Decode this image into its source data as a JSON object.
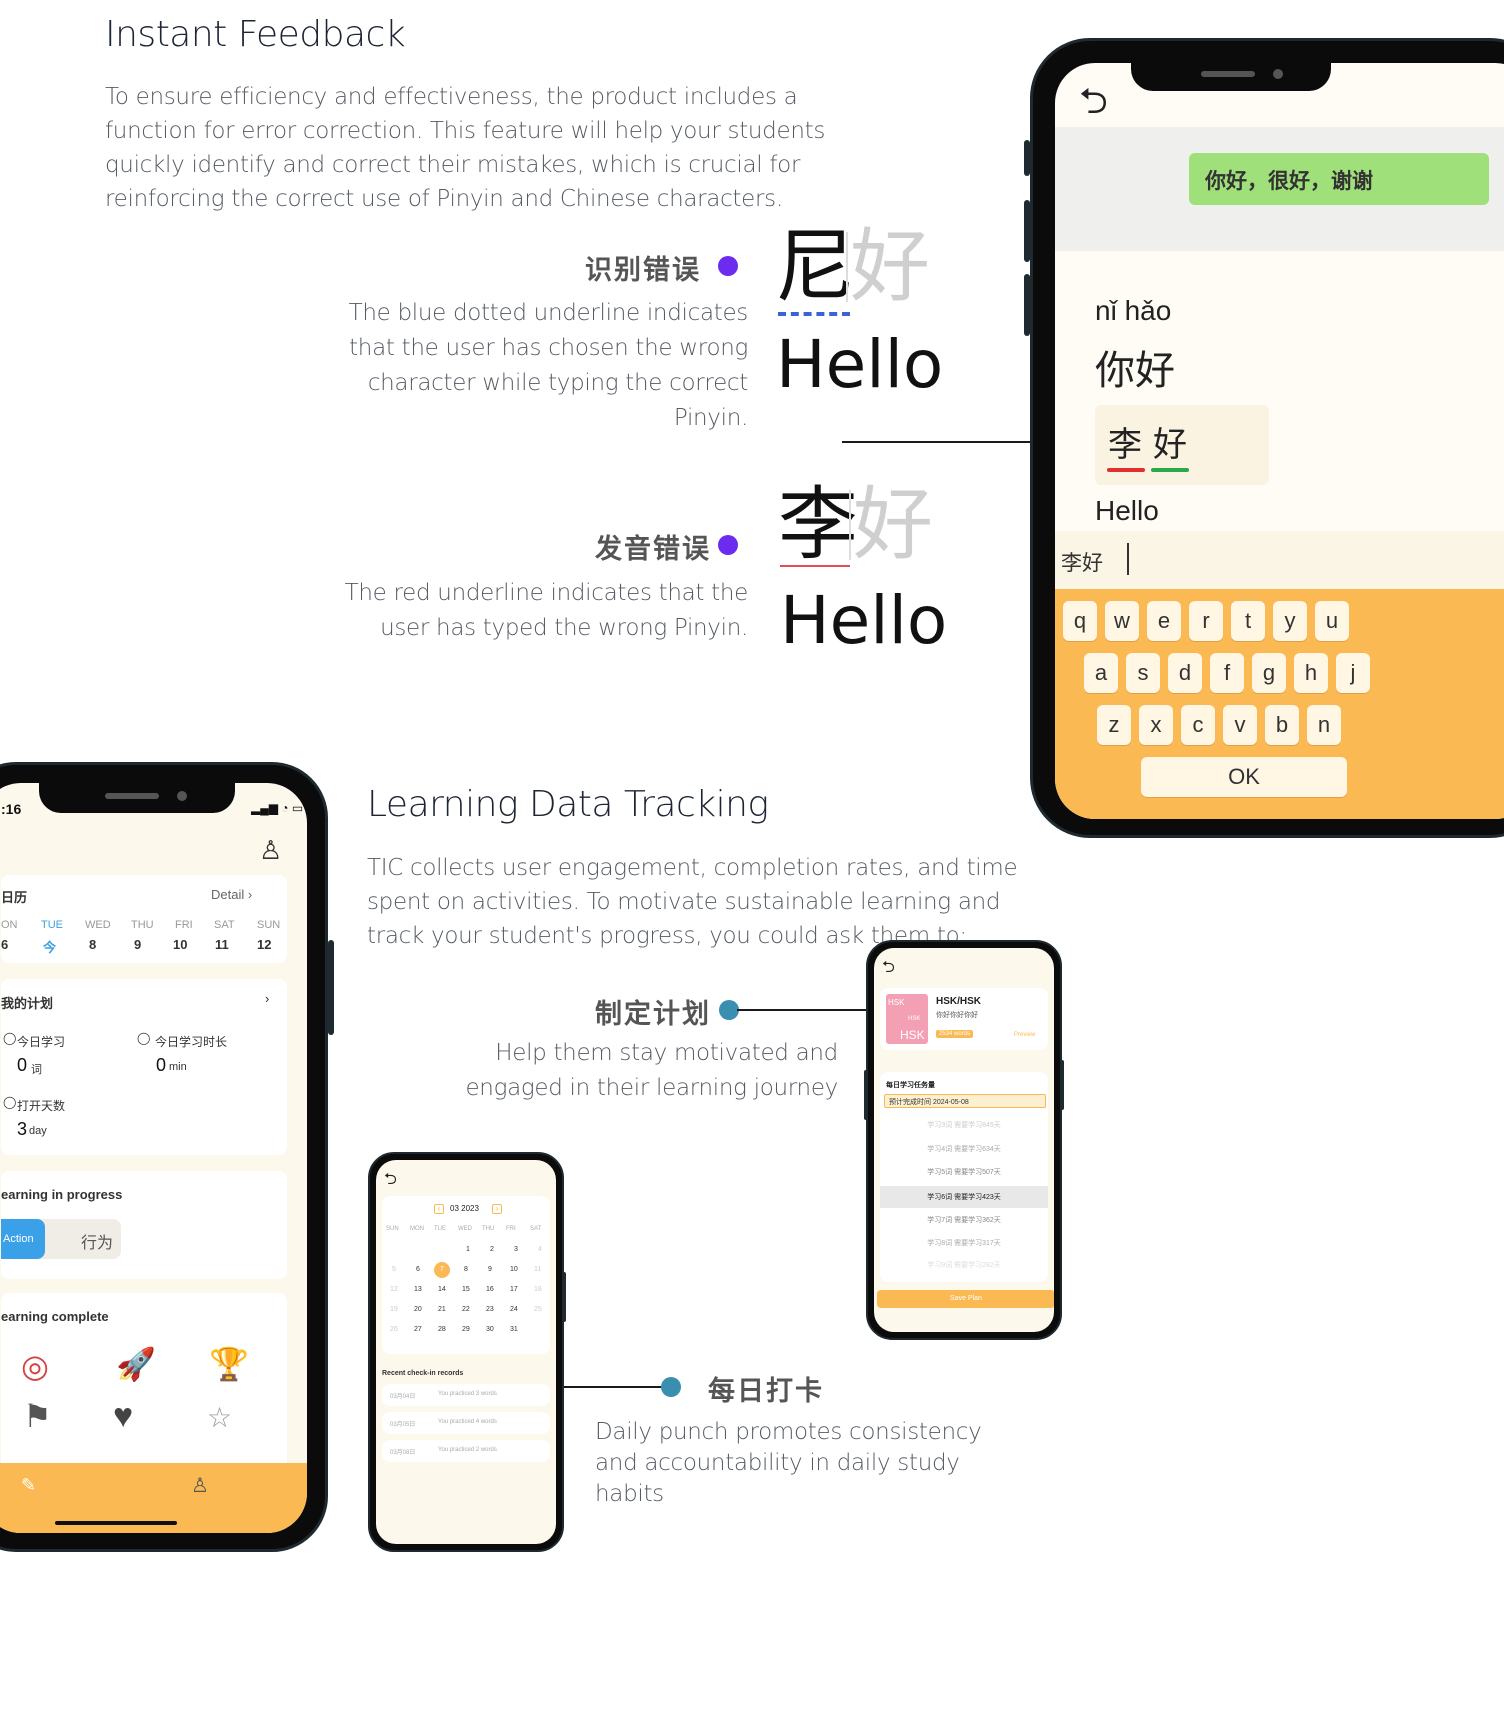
{
  "section1": {
    "title": "Instant Feedback",
    "body": "To ensure efficiency and effectiveness, the product includes a function for error correction. This feature will help your students quickly identify and correct their mistakes, which is crucial for reinforcing the correct use of Pinyin and Chinese characters."
  },
  "feature_wrong_char": {
    "title": "识别错误",
    "desc": "The blue dotted underline indicates that the user has chosen the wrong character while typing the correct Pinyin.",
    "char1": "尼",
    "char2": "好",
    "word": "Hello",
    "dot_color": "#6b2cf0",
    "underline_color": "#3c63d6"
  },
  "feature_wrong_pinyin": {
    "title": "发音错误",
    "desc": "The red underline indicates that the user has typed the wrong Pinyin.",
    "char1": "李",
    "char2": "好",
    "word": "Hello",
    "dot_color": "#6b2cf0",
    "underline_color": "#e05050"
  },
  "phone_feedback": {
    "back_icon": "back-arrow-icon",
    "prompt": "你好，很好，谢谢",
    "pinyin": "nǐ hǎo",
    "hanzi": "你好",
    "answer_char1": "李",
    "answer_char2": "好",
    "english": "Hello",
    "input_text": "李好",
    "keys_row1": [
      "q",
      "w",
      "e",
      "r",
      "t",
      "y",
      "u"
    ],
    "keys_row2": [
      "a",
      "s",
      "d",
      "f",
      "g",
      "h",
      "j"
    ],
    "keys_row3": [
      "z",
      "x",
      "c",
      "v",
      "b",
      "n"
    ],
    "ok_label": "OK"
  },
  "section2": {
    "title": "Learning Data Tracking",
    "body": "TIC collects user engagement, completion rates, and time spent on activities. To motivate sustainable learning and track your student's progress, you could ask them to:"
  },
  "feature_plan": {
    "title": "制定计划",
    "desc": "Help them stay motivated and engaged in their learning journey",
    "dot_color": "#3a8fb0"
  },
  "feature_punch": {
    "title": "每日打卡",
    "desc": "Daily punch promotes consistency and accountability in daily study habits",
    "dot_color": "#3a8fb0"
  },
  "phone_home": {
    "time": ":16",
    "calendar_label": "日历",
    "detail_label": "Detail",
    "weekdays": [
      "ON",
      "TUE",
      "WED",
      "THU",
      "FRI",
      "SAT",
      "SUN"
    ],
    "days": [
      "6",
      "今",
      "8",
      "9",
      "10",
      "11",
      "12"
    ],
    "plan_label": "我的计划",
    "today_study": "今日学习",
    "today_study_value": "0",
    "today_study_unit": "词",
    "today_time": "今日学习时长",
    "today_time_value": "0",
    "today_time_unit": "min",
    "checkin_days": "打开天数",
    "checkin_value": "3",
    "checkin_unit": "day",
    "in_progress": "earning in progress",
    "action_tab": "Action",
    "action_cn": "行为",
    "complete": "earning complete"
  },
  "phone_plan": {
    "book_title": "HSK/HSK",
    "book_sub": "你好你好你好",
    "book_badge": "2534 words",
    "preview": "Preview",
    "cover_text1": "HSK",
    "cover_text2": "HSK",
    "cover_text3": "HSK",
    "task_label": "每日学习任务量",
    "deadline": "预计完成时间 2024-05-08",
    "options": [
      "学习3词 需要学习845天",
      "学习4词 需要学习634天",
      "学习5词 需要学习507天",
      "学习6词 需要学习423天",
      "学习7词 需要学习362天",
      "学习8词 需要学习317天",
      "学习9词 需要学习282天"
    ],
    "save_label": "Save Plan"
  },
  "phone_calendar": {
    "month": "03 2023",
    "weekdays": [
      "SUN",
      "MON",
      "TUE",
      "WED",
      "THU",
      "FRI",
      "SAT"
    ],
    "row1": [
      "",
      "",
      "",
      "1",
      "2",
      "3",
      "4"
    ],
    "row2": [
      "5",
      "6",
      "7",
      "8",
      "9",
      "10",
      "11"
    ],
    "row3": [
      "12",
      "13",
      "14",
      "15",
      "16",
      "17",
      "18"
    ],
    "row4": [
      "19",
      "20",
      "21",
      "22",
      "23",
      "24",
      "25"
    ],
    "row5": [
      "26",
      "27",
      "28",
      "29",
      "30",
      "31",
      ""
    ],
    "records_label": "Recent check-in records",
    "records": [
      {
        "date": "03月04日",
        "text": "You practiced 3 words"
      },
      {
        "date": "03月05日",
        "text": "You practiced 4 words"
      },
      {
        "date": "03月08日",
        "text": "You practiced 2 words"
      }
    ]
  },
  "colors": {
    "accent_orange": "#fbb954",
    "green_prompt": "#9fe07a",
    "purple_dot": "#6b2cf0",
    "teal_dot": "#3a8fb0"
  }
}
